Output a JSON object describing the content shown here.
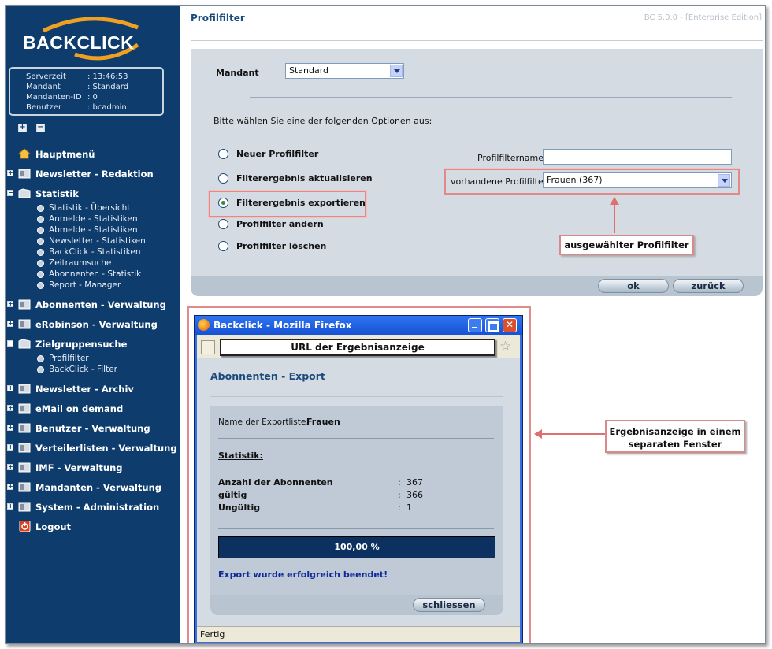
{
  "sidebar": {
    "logo": "BACKCLICK",
    "info": [
      {
        "key": "Serverzeit",
        "value": ": 13:46:53"
      },
      {
        "key": "Mandant",
        "value": ": Standard"
      },
      {
        "key": "Mandanten-ID",
        "value": ": 0"
      },
      {
        "key": "Benutzer",
        "value": ": bcadmin"
      }
    ],
    "menu": {
      "hauptmenu": "Hauptmenü",
      "newsletter_redaktion": "Newsletter - Redaktion",
      "statistik": "Statistik",
      "statistik_items": [
        "Statistik - Übersicht",
        "Anmelde - Statistiken",
        "Abmelde - Statistiken",
        "Newsletter - Statistiken",
        "BackClick - Statistiken",
        "Zeitraumsuche",
        "Abonnenten - Statistik",
        "Report - Manager"
      ],
      "abonnenten": "Abonnenten - Verwaltung",
      "erobinson": "eRobinson - Verwaltung",
      "zielgruppensuche": "Zielgruppensuche",
      "zielgruppen_items": [
        "Profilfilter",
        "BackClick - Filter"
      ],
      "newsletter_archiv": "Newsletter - Archiv",
      "email_on_demand": "eMail on demand",
      "benutzer": "Benutzer - Verwaltung",
      "verteilerlisten": "Verteilerlisten - Verwaltung",
      "imf": "IMF - Verwaltung",
      "mandanten": "Mandanten - Verwaltung",
      "system": "System - Administration",
      "logout": "Logout"
    }
  },
  "header": {
    "title": "Profilfilter",
    "version": "BC 5.0.0 - [Enterprise Edition]"
  },
  "form": {
    "mandant_label": "Mandant",
    "mandant_value": "Standard",
    "instruction": "Bitte wählen Sie eine der folgenden Optionen aus:",
    "options": [
      "Neuer Profilfilter",
      "Filterergebnis aktualisieren",
      "Filterergebnis exportieren",
      "Profilfilter ändern",
      "Profilfilter löschen"
    ],
    "selected_option": "Filterergebnis exportieren",
    "name_label": "Profilfiltername :",
    "name_value": "",
    "existing_label": "vorhandene Profilfilter :",
    "existing_value": "Frauen (367)",
    "ok": "ok",
    "back": "zurück"
  },
  "callouts": {
    "selected_filter": "ausgewählter Profilfilter",
    "result_window": "Ergebnisanzeige in einem separaten Fenster"
  },
  "popup": {
    "window_title": "Backclick - Mozilla Firefox",
    "url": "URL der Ergebnisanzeige",
    "page_title": "Abonnenten - Export",
    "export_list_label": "Name der Exportliste:",
    "export_list_value": "Frauen",
    "stats_heading": "Statistik:",
    "stats": [
      {
        "label": "Anzahl der Abonnenten",
        "value": "367"
      },
      {
        "label": "gültig",
        "value": "366"
      },
      {
        "label": "Ungültig",
        "value": "1"
      }
    ],
    "progress_text": "100,00 %",
    "progress_fraction": 1.0,
    "success": "Export wurde erfolgreich beendet!",
    "close_button": "schliessen",
    "status": "Fertig"
  }
}
